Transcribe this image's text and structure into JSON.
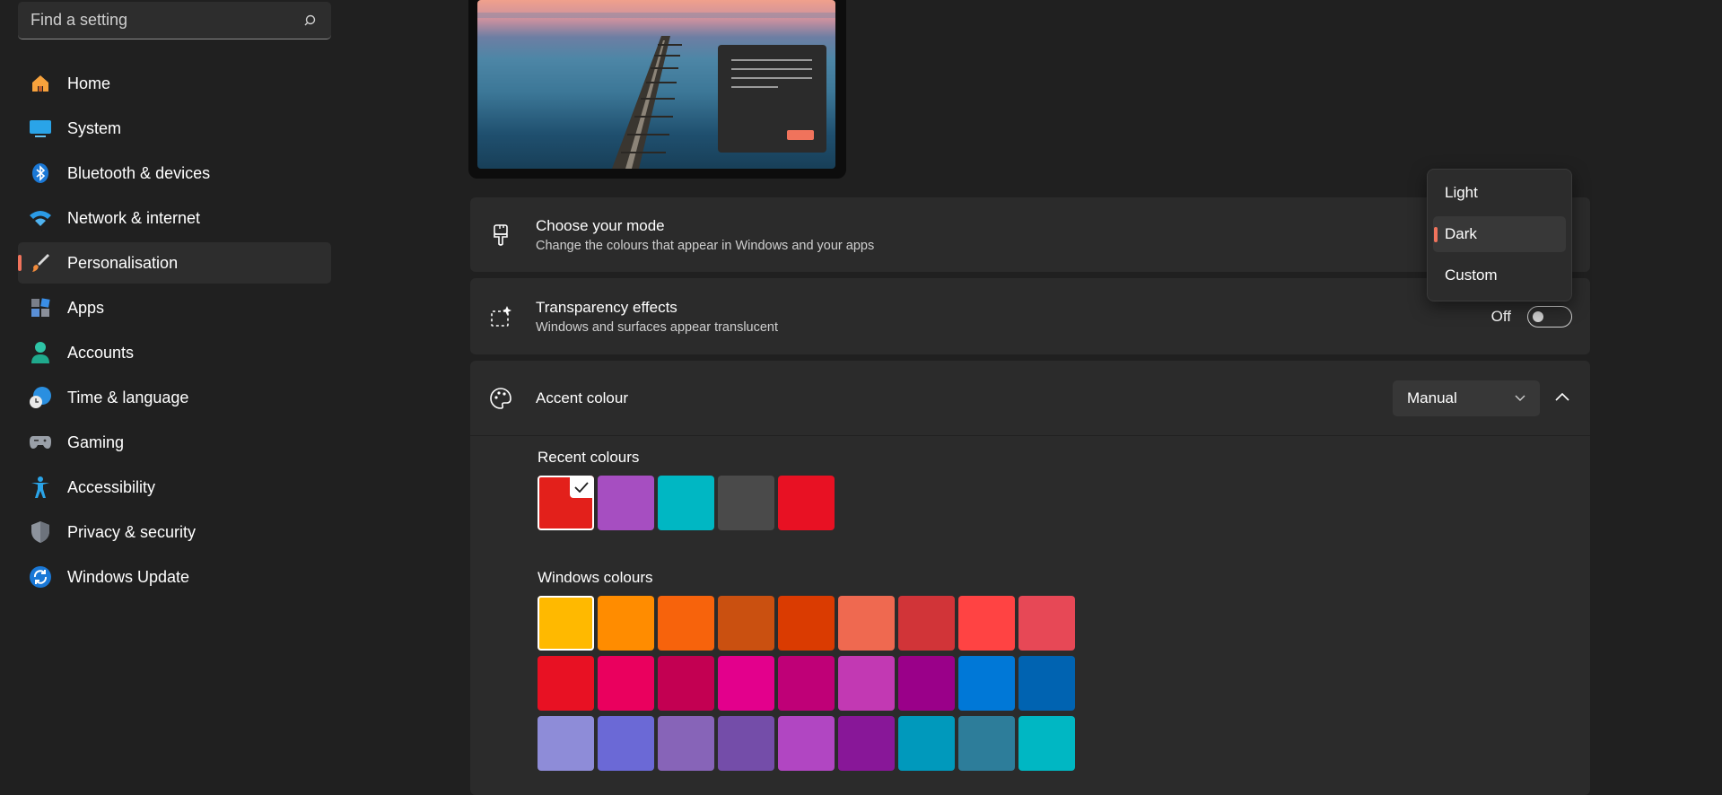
{
  "search": {
    "placeholder": "Find a setting",
    "icon": "search-icon"
  },
  "sidebar": {
    "items": [
      {
        "label": "Home",
        "icon": "home-icon"
      },
      {
        "label": "System",
        "icon": "system-icon"
      },
      {
        "label": "Bluetooth & devices",
        "icon": "bluetooth-icon"
      },
      {
        "label": "Network & internet",
        "icon": "wifi-icon"
      },
      {
        "label": "Personalisation",
        "icon": "brush-icon",
        "active": true
      },
      {
        "label": "Apps",
        "icon": "apps-icon"
      },
      {
        "label": "Accounts",
        "icon": "account-icon"
      },
      {
        "label": "Time & language",
        "icon": "globe-clock-icon"
      },
      {
        "label": "Gaming",
        "icon": "gamepad-icon"
      },
      {
        "label": "Accessibility",
        "icon": "accessibility-icon"
      },
      {
        "label": "Privacy & security",
        "icon": "shield-icon"
      },
      {
        "label": "Windows Update",
        "icon": "update-icon"
      }
    ]
  },
  "mode": {
    "title": "Choose your mode",
    "subtitle": "Change the colours that appear in Windows and your apps",
    "options": [
      "Light",
      "Dark",
      "Custom"
    ],
    "selected": "Dark"
  },
  "transparency": {
    "title": "Transparency effects",
    "subtitle": "Windows and surfaces appear translucent",
    "state": "Off"
  },
  "accent": {
    "title": "Accent colour",
    "dropdown_value": "Manual",
    "recent_label": "Recent colours",
    "windows_label": "Windows colours",
    "recent_colours": [
      "#e3201b",
      "#a64ec1",
      "#00b7c3",
      "#4a4a4a",
      "#e81123"
    ],
    "windows_colours": [
      [
        "#ffb900",
        "#ff8c00",
        "#f7630c",
        "#ca5010",
        "#da3b01",
        "#ef6950",
        "#d13438",
        "#ff4343",
        "#e74856"
      ],
      [
        "#e81123",
        "#ea005e",
        "#c30052",
        "#e3008c",
        "#bf0077",
        "#c239b3",
        "#9a0089",
        "#0078d7",
        "#0063b1"
      ],
      [
        "#8e8cd8",
        "#6b69d6",
        "#8764b8",
        "#744da9",
        "#b146c2",
        "#881798",
        "#0099bc",
        "#2d7d9a",
        "#00b7c3"
      ]
    ]
  },
  "colors": {
    "accent": "#f0735c",
    "background": "#202020",
    "card": "#2b2b2b"
  }
}
